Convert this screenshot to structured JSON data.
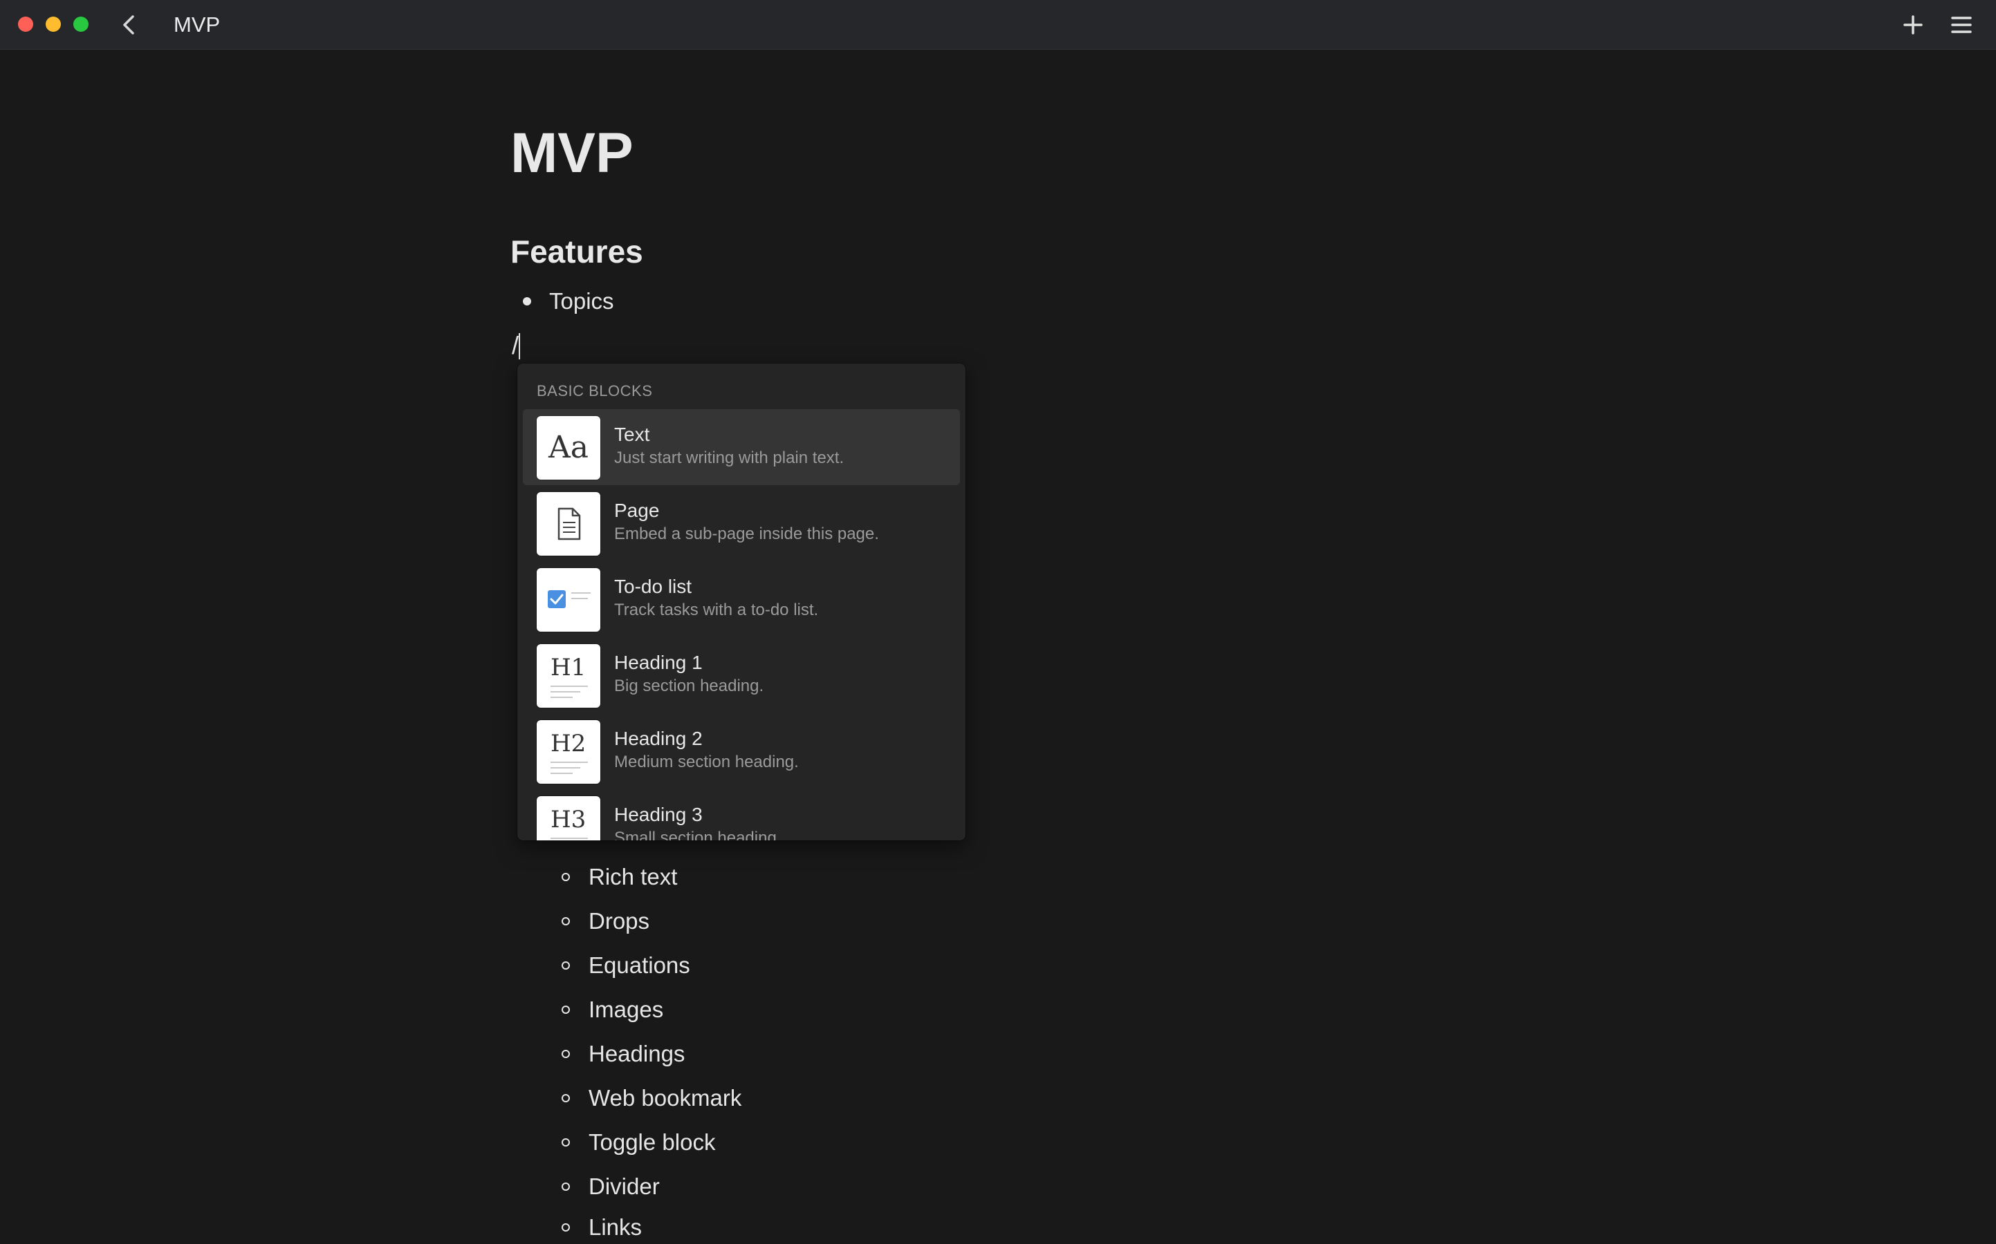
{
  "window": {
    "title": "MVP"
  },
  "titlebar": {
    "icons": [
      "close-button",
      "minimize-button",
      "maximize-button",
      "chevron-left-icon",
      "plus-icon",
      "hamburger-menu-icon"
    ]
  },
  "document": {
    "title": "MVP",
    "section_heading": "Features",
    "top_bullets": [
      {
        "label": "Topics"
      }
    ],
    "command_input": "/",
    "sub_bullets": [
      {
        "label": "Rich text"
      },
      {
        "label": "Drops"
      },
      {
        "label": "Equations"
      },
      {
        "label": "Images"
      },
      {
        "label": "Headings"
      },
      {
        "label": "Web bookmark"
      },
      {
        "label": "Toggle block"
      },
      {
        "label": "Divider"
      },
      {
        "label": "Links"
      }
    ]
  },
  "slash_menu": {
    "section_label": "BASIC BLOCKS",
    "items": [
      {
        "label": "Text",
        "description": "Just start writing with plain text.",
        "icon": "text-aa-icon",
        "active": true
      },
      {
        "label": "Page",
        "description": "Embed a sub-page inside this page.",
        "icon": "page-icon",
        "active": false
      },
      {
        "label": "To-do list",
        "description": "Track tasks with a to-do list.",
        "icon": "todo-checkbox-icon",
        "active": false
      },
      {
        "label": "Heading 1",
        "description": "Big section heading.",
        "icon": "heading1-icon",
        "active": false
      },
      {
        "label": "Heading 2",
        "description": "Medium section heading.",
        "icon": "heading2-icon",
        "active": false
      },
      {
        "label": "Heading 3",
        "description": "Small section heading.",
        "icon": "heading3-icon",
        "active": false
      }
    ],
    "icon_glyphs": {
      "text": "Aa",
      "h1": "H1",
      "h2": "H2",
      "h3": "H3"
    }
  },
  "colors": {
    "background": "#191919",
    "titlebar": "#25272b",
    "menu_background": "#252525",
    "menu_active": "#353535",
    "checkbox_accent": "#4a90e2",
    "traffic_close": "#fe5f57",
    "traffic_minimize": "#febc2e",
    "traffic_maximize": "#28c840"
  }
}
